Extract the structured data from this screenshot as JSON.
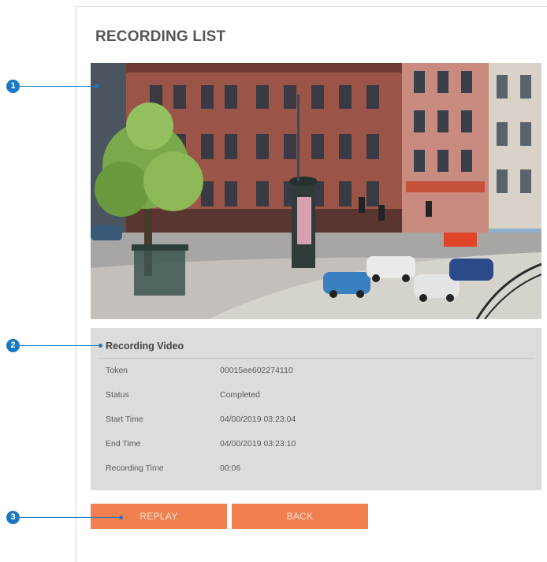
{
  "page": {
    "title": "RECORDING LIST"
  },
  "info": {
    "heading": "Recording Video",
    "rows": [
      {
        "label": "Token",
        "value": "00015ee602274110"
      },
      {
        "label": "Status",
        "value": "Completed"
      },
      {
        "label": "Start Time",
        "value": "04/00/2019 03:23:04"
      },
      {
        "label": "End Time",
        "value": "04/00/2019 03:23:10"
      },
      {
        "label": "Recording Time",
        "value": "00:06"
      }
    ]
  },
  "buttons": {
    "replay": "REPLAY",
    "back": "BACK"
  },
  "callouts": [
    "1",
    "2",
    "3"
  ],
  "colors": {
    "button": "#f08050",
    "callout": "#1a78c2",
    "panel": "#dcdcdc"
  }
}
